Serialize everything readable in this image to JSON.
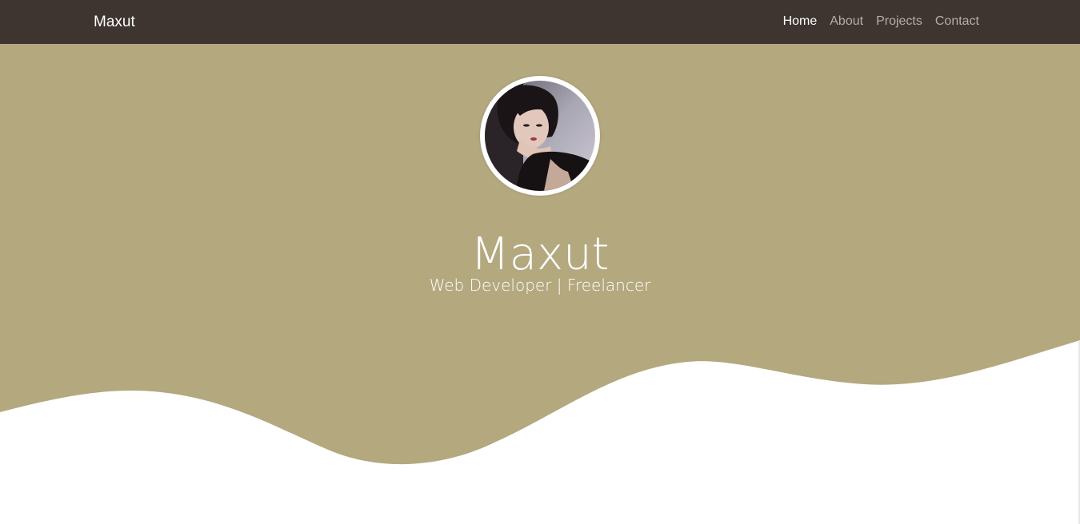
{
  "navbar": {
    "brand": "Maxut",
    "links": [
      {
        "label": "Home",
        "active": true
      },
      {
        "label": "About",
        "active": false
      },
      {
        "label": "Projects",
        "active": false
      },
      {
        "label": "Contact",
        "active": false
      }
    ]
  },
  "hero": {
    "title": "Maxut",
    "subtitle": "Web Developer | Freelancer",
    "avatar": "profile-photo"
  },
  "colors": {
    "navbar": "#3e3430",
    "hero": "#b4a87f",
    "text": "#ffffff",
    "nav_inactive": "#b5aea6"
  }
}
